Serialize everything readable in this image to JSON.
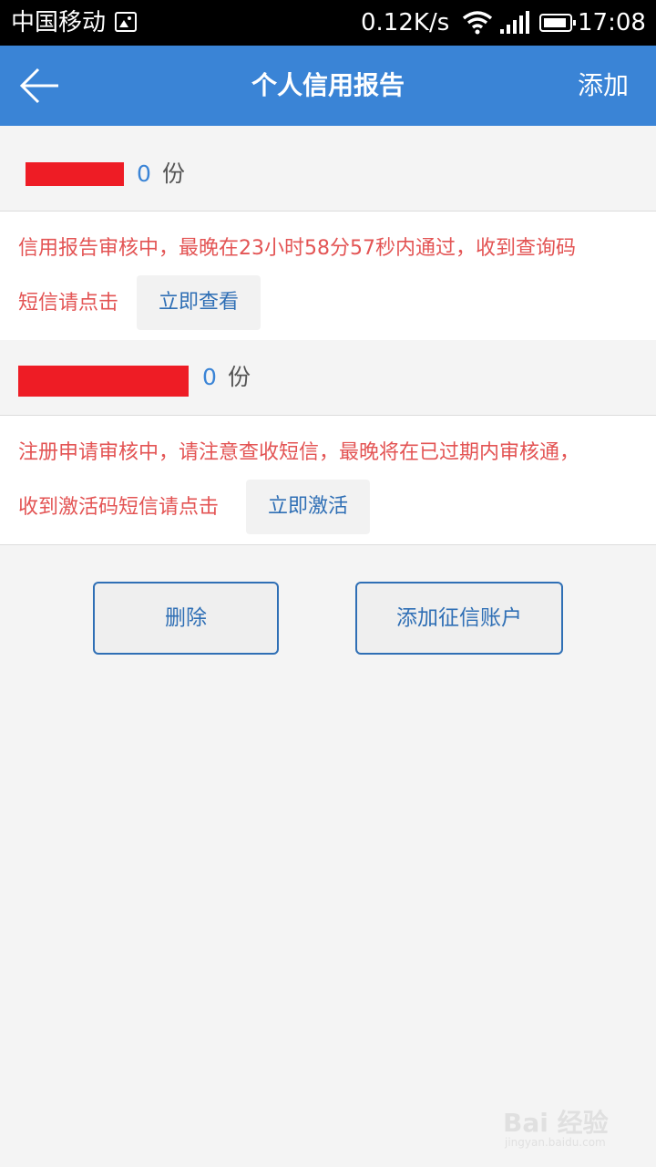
{
  "status_bar": {
    "carrier": "中国移动",
    "speed": "0.12K/s",
    "time": "17:08",
    "icons": [
      "image-icon",
      "wifi-icon",
      "signal-icon",
      "battery-icon"
    ]
  },
  "nav": {
    "back_icon": "back-arrow-icon",
    "title": "个人信用报告",
    "add_label": "添加"
  },
  "accounts": [
    {
      "count": "0",
      "unit": "份",
      "message_line1": "信用报告审核中，最晚在23小时58分57秒内通过，收到查询码",
      "message_line2": "短信请点击",
      "action_label": "立即查看"
    },
    {
      "count": "0",
      "unit": "份",
      "message_line1": "注册申请审核中，请注意查收短信，最晚将在已过期内审核通，",
      "message_line2": "收到激活码短信请点击",
      "action_label": "立即激活"
    }
  ],
  "buttons": {
    "delete_label": "删除",
    "add_account_label": "添加征信账户"
  },
  "watermark": {
    "text": "Bai 经验",
    "sub": "jingyan.baidu.com"
  },
  "colors": {
    "nav_bg": "#3a84d6",
    "alert_text": "#e35454",
    "link_blue": "#2f6fb5",
    "redaction": "#ee1c25"
  }
}
